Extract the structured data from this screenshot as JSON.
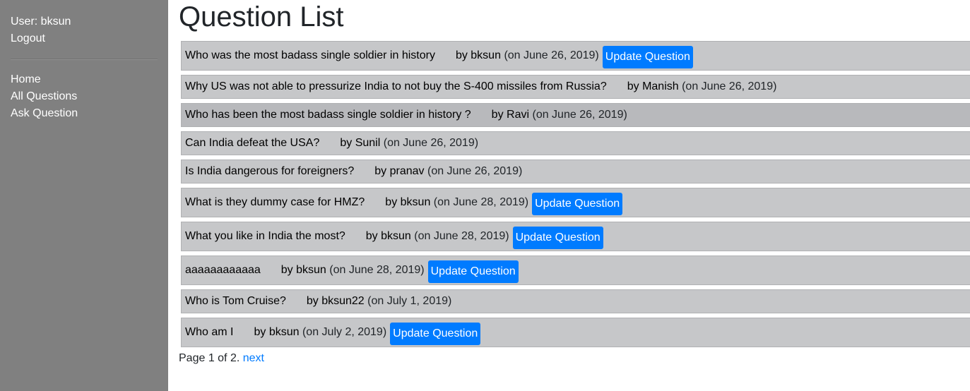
{
  "sidebar": {
    "user_label": "User: bksun",
    "logout": "Logout",
    "nav": [
      "Home",
      "All Questions",
      "Ask Question"
    ]
  },
  "page_title": "Question List",
  "questions": [
    {
      "text": "Who was the most badass single soldier in history",
      "by": "by bksun",
      "date": "(on June 26, 2019)",
      "update": "Update Question"
    },
    {
      "text": "Why US was not able to pressurize India to not buy the S-400 missiles from Russia?",
      "by": "by Manish",
      "date": "(on June 26, 2019)"
    },
    {
      "text": "Who has been the most badass single soldier in history ?",
      "by": "by Ravi",
      "date": "(on June 26, 2019)"
    },
    {
      "text": "Can India defeat the USA?",
      "by": "by Sunil",
      "date": "(on June 26, 2019)"
    },
    {
      "text": "Is India dangerous for foreigners?",
      "by": "by pranav",
      "date": "(on June 26, 2019)"
    },
    {
      "text": "What is they dummy case for HMZ?",
      "by": "by bksun",
      "date": "(on June 28, 2019)",
      "update": "Update Question"
    },
    {
      "text": "What you like in India the most?",
      "by": "by bksun",
      "date": "(on June 28, 2019)",
      "update": "Update Question"
    },
    {
      "text": "aaaaaaaaaaaa",
      "by": "by bksun",
      "date": "(on June 28, 2019)",
      "update": "Update Question"
    },
    {
      "text": "Who is Tom Cruise?",
      "by": "by bksun22",
      "date": "(on July 1, 2019)"
    },
    {
      "text": "Who am I",
      "by": "by bksun",
      "date": "(on July 2, 2019)",
      "update": "Update Question"
    }
  ],
  "pager": {
    "text": "Page 1 of 2.",
    "next": "next"
  }
}
